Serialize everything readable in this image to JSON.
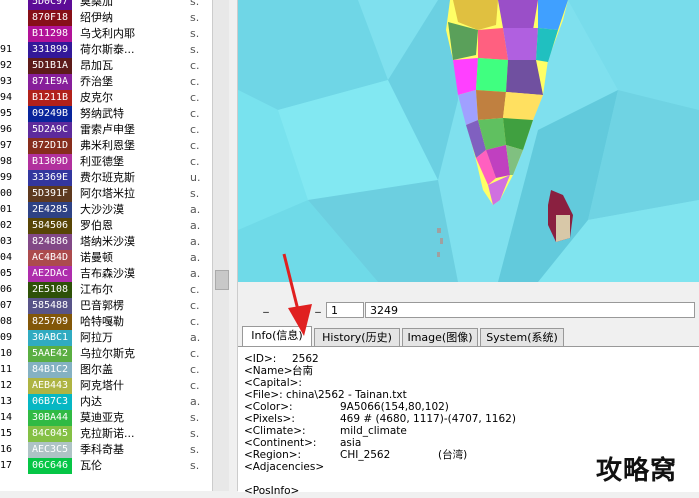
{
  "province_list": [
    {
      "idx": "",
      "hex": "5D0C97",
      "color": "#5D0C97",
      "name": "莫桑加",
      "type": "s."
    },
    {
      "idx": "",
      "hex": "870F18",
      "color": "#870F18",
      "name": "绍伊纳",
      "type": "s."
    },
    {
      "idx": "",
      "hex": "B11298",
      "color": "#B11298",
      "name": "乌戈利内耶",
      "type": "s."
    },
    {
      "idx": "91",
      "hex": "331899",
      "color": "#331899",
      "name": "荷尔斯泰...",
      "type": "s."
    },
    {
      "idx": "92",
      "hex": "5D1B1A",
      "color": "#5D1B1A",
      "name": "昂加瓦",
      "type": "c."
    },
    {
      "idx": "93",
      "hex": "871E9A",
      "color": "#871E9A",
      "name": "乔治堡",
      "type": "c."
    },
    {
      "idx": "94",
      "hex": "B1211B",
      "color": "#B1211B",
      "name": "皮克尔",
      "type": "c."
    },
    {
      "idx": "95",
      "hex": "09249B",
      "color": "#09249B",
      "name": "努纳武特",
      "type": "c."
    },
    {
      "idx": "96",
      "hex": "5D2A9C",
      "color": "#5D2A9C",
      "name": "雷索卢申堡",
      "type": "c."
    },
    {
      "idx": "97",
      "hex": "872D1D",
      "color": "#872D1D",
      "name": "弗米利恩堡",
      "type": "c."
    },
    {
      "idx": "98",
      "hex": "B1309D",
      "color": "#B1309D",
      "name": "利亚德堡",
      "type": "c."
    },
    {
      "idx": "99",
      "hex": "33369E",
      "color": "#33369E",
      "name": "费尔班克斯",
      "type": "u."
    },
    {
      "idx": "00",
      "hex": "5D391F",
      "color": "#5D391F",
      "name": "阿尔塔米拉",
      "type": "s."
    },
    {
      "idx": "01",
      "hex": "2E4285",
      "color": "#2E4285",
      "name": "大沙沙漠",
      "type": "a."
    },
    {
      "idx": "02",
      "hex": "584506",
      "color": "#584506",
      "name": "罗伯恩",
      "type": "a."
    },
    {
      "idx": "03",
      "hex": "824886",
      "color": "#824886",
      "name": "塔纳米沙漠",
      "type": "a."
    },
    {
      "idx": "04",
      "hex": "AC4B4D",
      "color": "#AC4B4D",
      "name": "诺曼顿",
      "type": "a."
    },
    {
      "idx": "05",
      "hex": "AE2DAC",
      "color": "#AE2DAC",
      "name": "吉布森沙漠",
      "type": "a."
    },
    {
      "idx": "06",
      "hex": "2E5108",
      "color": "#2E5108",
      "name": "江布尔",
      "type": "c."
    },
    {
      "idx": "07",
      "hex": "585488",
      "color": "#585488",
      "name": "巴音郭楞",
      "type": "c."
    },
    {
      "idx": "08",
      "hex": "825709",
      "color": "#825709",
      "name": "哈特嘎勒",
      "type": "c."
    },
    {
      "idx": "09",
      "hex": "30ABC1",
      "color": "#30ABC1",
      "name": "阿拉万",
      "type": "a."
    },
    {
      "idx": "10",
      "hex": "5AAE42",
      "color": "#5AAE42",
      "name": "乌拉尔斯克",
      "type": "c."
    },
    {
      "idx": "11",
      "hex": "84B1C2",
      "color": "#84B1C2",
      "name": "图尔盖",
      "type": "c."
    },
    {
      "idx": "12",
      "hex": "AEB443",
      "color": "#AEB443",
      "name": "阿克塔什",
      "type": "c."
    },
    {
      "idx": "13",
      "hex": "06B7C3",
      "color": "#06B7C3",
      "name": "内达",
      "type": "a."
    },
    {
      "idx": "14",
      "hex": "30BA44",
      "color": "#30BA44",
      "name": "莫迪亚克",
      "type": "s."
    },
    {
      "idx": "15",
      "hex": "84C045",
      "color": "#84C045",
      "name": "克拉斯诺...",
      "type": "s."
    },
    {
      "idx": "16",
      "hex": "AEC3C5",
      "color": "#AEC3C5",
      "name": "季科奇基",
      "type": "s."
    },
    {
      "idx": "17",
      "hex": "06C646",
      "color": "#06C646",
      "name": "瓦伦",
      "type": "s."
    }
  ],
  "controls": {
    "btn1": "_",
    "btn2": "_",
    "field1": "1",
    "field2": "3249"
  },
  "tabs": [
    {
      "label": "Info(信息)"
    },
    {
      "label": "History(历史)"
    },
    {
      "label": "Image(图像)"
    },
    {
      "label": "System(系统)"
    }
  ],
  "info": {
    "id_key": "<ID>:",
    "id_val": "2562",
    "name_key": "<Name>:",
    "name_val": "台南",
    "capital_key": "<Capital>:",
    "file_key": "<File>:",
    "file_val": "china\\2562 - Tainan.txt",
    "color_key": "<Color>:",
    "color_val": "9A5066(154,80,102)",
    "pixels_key": "<Pixels>:",
    "pixels_val": "469      # (4680, 1117)-(4707, 1162)",
    "climate_key": "<Climate>:",
    "climate_val": "mild_climate",
    "continent_key": "<Continent>:",
    "continent_val": "asia",
    "region_key": "<Region>:",
    "region_val": "CHI_2562",
    "region_note": "(台湾)",
    "adjacencies_key": "<Adjacencies>",
    "posinfo_key": "<PosInfo>"
  },
  "watermark": "攻略窝",
  "colors": {
    "map_sea": "#7fe0ee",
    "arrow": "#e02020"
  }
}
